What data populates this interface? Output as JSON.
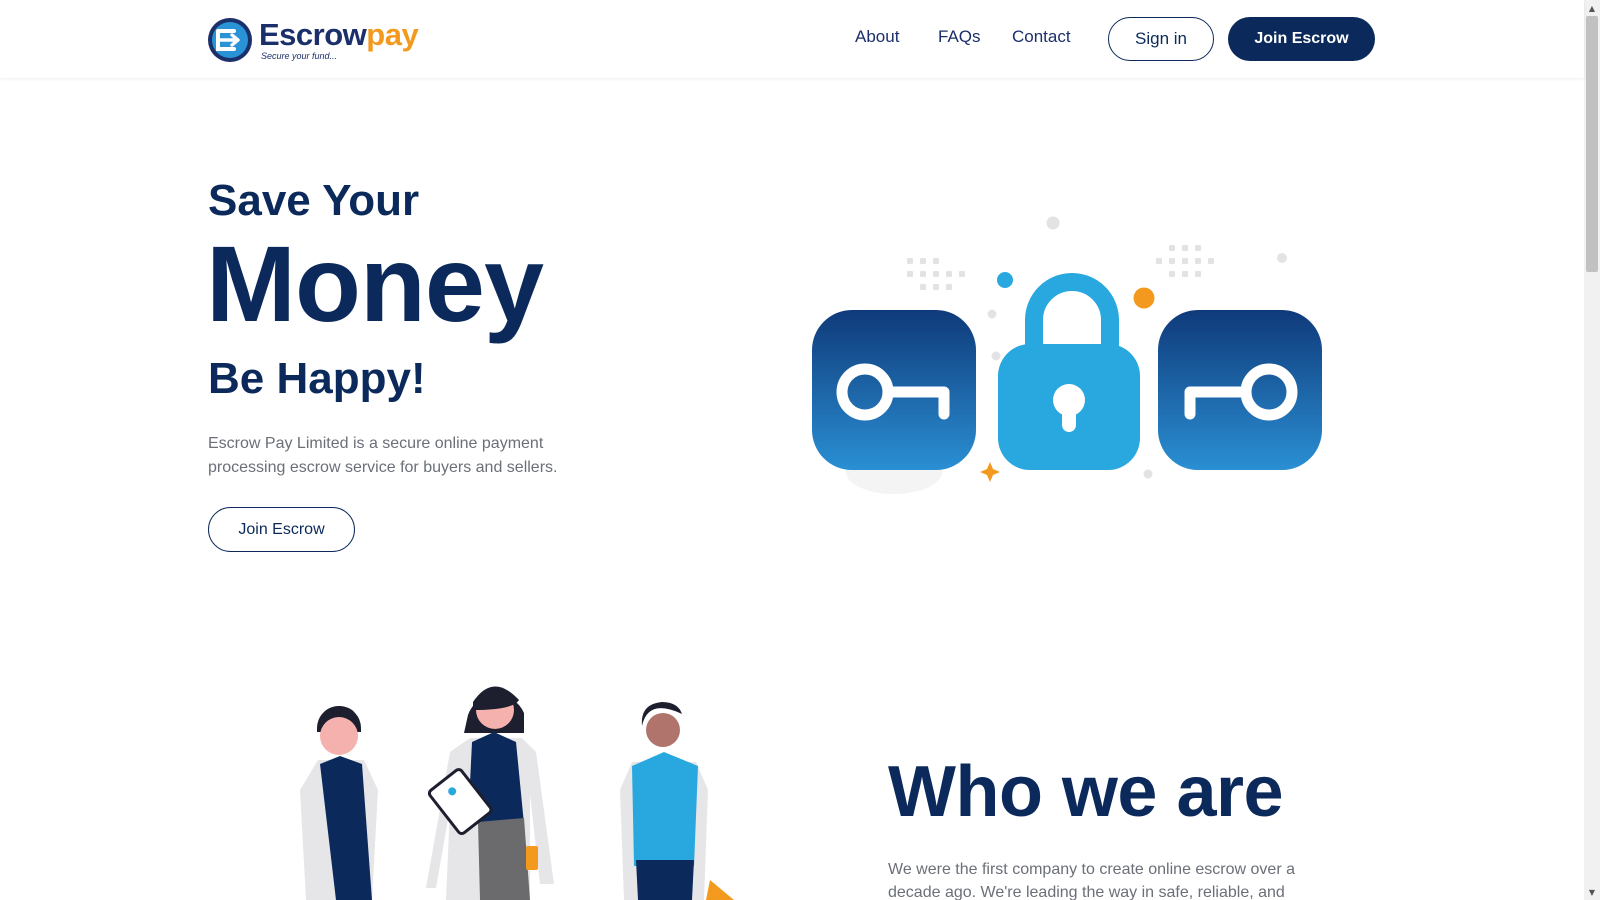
{
  "header": {
    "logo": {
      "word_part1": "Escrow",
      "word_part2": "pay",
      "tagline": "Secure your fund..."
    },
    "nav": {
      "about": "About",
      "faqs": "FAQs",
      "contact": "Contact"
    },
    "sign_in_label": "Sign in",
    "join_label": "Join Escrow"
  },
  "hero": {
    "line1": "Save Your",
    "line2": "Money",
    "line3": "Be Happy!",
    "description": "Escrow Pay Limited is a secure online payment processing escrow service for buyers and sellers.",
    "cta_label": "Join Escrow",
    "illustration_icons": [
      "key-icon",
      "padlock-icon",
      "key-icon"
    ]
  },
  "who": {
    "title": "Who we are",
    "text": "We were the first company to create online escrow over a decade ago. We're leading the way in safe, reliable, and"
  },
  "colors": {
    "navy": "#0b2a5b",
    "brand_orange": "#f39a1e",
    "light_blue": "#29a8e0",
    "text_gray": "#6b6f78"
  }
}
